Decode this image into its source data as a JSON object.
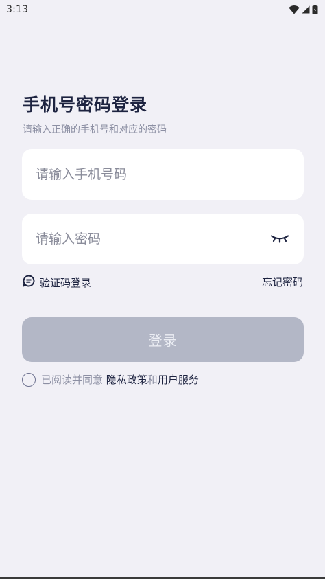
{
  "status_bar": {
    "time": "3:13",
    "icons": [
      "wifi-icon",
      "cellular-signal-icon",
      "battery-charging-icon"
    ]
  },
  "header": {
    "title": "手机号密码登录",
    "subtitle": "请输入正确的手机号和对应的密码"
  },
  "form": {
    "phone_placeholder": "请输入手机号码",
    "password_placeholder": "请输入密码",
    "password_visibility_icon": "eye-closed-icon",
    "sms_login_label": "验证码登录",
    "sms_login_icon": "message-bubble-icon",
    "forgot_password_label": "忘记密码",
    "login_button_label": "登录"
  },
  "agreement": {
    "prefix": "已阅读并同意 ",
    "privacy_policy": "隐私政策",
    "and": "和",
    "user_service": "用户服务",
    "checked": false
  },
  "colors": {
    "background": "#f1f0f6",
    "title_text": "#1d2340",
    "muted_text": "#8c8fa3",
    "disabled_button": "#b3b7c6"
  }
}
